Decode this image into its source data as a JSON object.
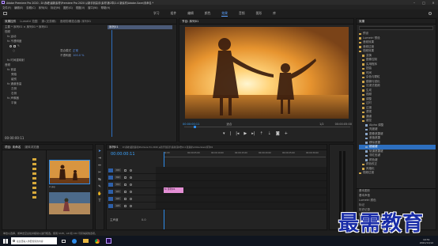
{
  "title_bar": {
    "title": "Adobe Premiere Pro 2020 - D:\\赤峰\\最新素材\\Premiere Pro 2020 从新手到高手\\素材\\第2章\\2.4 新素材\\Adobe-Save\\未命名 *",
    "controls": [
      "–",
      "□",
      "×"
    ]
  },
  "menu": [
    "文件(F)",
    "编辑(E)",
    "剪辑(C)",
    "序列(S)",
    "标记(M)",
    "图形(G)",
    "视图(V)",
    "窗口(W)",
    "帮助(H)"
  ],
  "workspaces": [
    "学习",
    "组件",
    "编辑",
    "颜色",
    "效果",
    "音频",
    "图形",
    "库"
  ],
  "workspace_active": "效果",
  "effect_controls": {
    "tabs": [
      "效果控件",
      "Lumetri 范围",
      "源:(无剪辑)",
      "音频剪辑混合器: 序列01"
    ],
    "source_path": "主要 * 序列01 × 序列01 * 序列01",
    "clip_chip": "序列01",
    "sections": [
      "视频",
      "fx 运动",
      "fx 不透明度",
      "fx 时间重映射",
      "音频"
    ],
    "props": [
      {
        "name": "混合模式",
        "value": "正常"
      },
      {
        "name": "不透明度",
        "value": "100.0 %"
      }
    ],
    "audio_items": [
      "fx 音量",
      "fx 通道音量",
      "fx 声像器"
    ],
    "sub_items": [
      "旁路",
      "级别",
      "左侧",
      "右侧",
      "平衡"
    ],
    "timecode": "00:00:00:11"
  },
  "program": {
    "tab": "节目: 序列01",
    "timecode_left": "00:00:00:11",
    "fit": "适合",
    "scale": "1/2",
    "timecode_right": "00:00:05:00"
  },
  "effects_panel": {
    "title": "效果",
    "items": [
      "预设",
      "Lumetri 预设",
      "音频效果",
      "音频过渡",
      "视频效果",
      "变换",
      "图像控制",
      "实用程序",
      "扭曲",
      "时间",
      "杂色与颗粒",
      "模糊与锐化",
      "沉浸式视频",
      "生成",
      "视频",
      "调整",
      "过时",
      "过渡",
      "透视",
      "通道",
      "键控",
      "Alpha 调整",
      "亮度键",
      "图像遮罩键",
      "差值遮罩",
      "移除遮罩",
      "超级键",
      "轨道遮罩键",
      "非红色键",
      "颜色键",
      "颜色校正",
      "风格化",
      "视频过渡"
    ],
    "highlighted": "超级键",
    "footer": [
      "基本图形",
      "基本声音",
      "Lumetri 颜色",
      "标记",
      "历史记录",
      "信息"
    ]
  },
  "project_panel": {
    "tabs": [
      "项目: 未命名",
      "媒体浏览器"
    ],
    "clips": [
      {
        "name": "序列01",
        "kind": "sequence"
      },
      {
        "name": "2.jpg",
        "kind": "sunset"
      },
      {
        "name": "1.jpg",
        "kind": "beach"
      },
      {
        "name": "音乐.mp3",
        "kind": "audio"
      }
    ]
  },
  "timeline": {
    "tab": "序列01",
    "path": "D:\\赤峰\\最新素材\\Premiere Pro 2020 从新手到高手\\素材\\第2章\\2.4 新素材\\Adobe-Save\\序列01",
    "timecode": "00:00:00:11",
    "ruler": [
      "00:00",
      "00:00:05:00",
      "00:00:10:00",
      "00:00:15:00",
      "00:00:20:00",
      "00:00:25:00",
      "00:00:30:00"
    ],
    "video_tracks": [
      "V3",
      "V2",
      "V1"
    ],
    "audio_tracks": [
      "A1",
      "A2",
      "A3"
    ],
    "master": "主声道",
    "master_value": "0.0",
    "clip_label": "fx 序列01"
  },
  "status_bar": {
    "text": "单击以选择，或单击空白处并拖动以进行框选。使用 Shift、Alt 和 Ctrl 可获得其他选项。"
  },
  "taskbar": {
    "search": "在这里输入你要搜索的内容",
    "time": "10:51",
    "date": "2021/11/12"
  },
  "watermark": "最需教育",
  "colors": {
    "accent": "#2d8ceb",
    "clip": "#e48fd5",
    "highlight": "#2d6fbf",
    "timecode": "#3aa3ff"
  }
}
